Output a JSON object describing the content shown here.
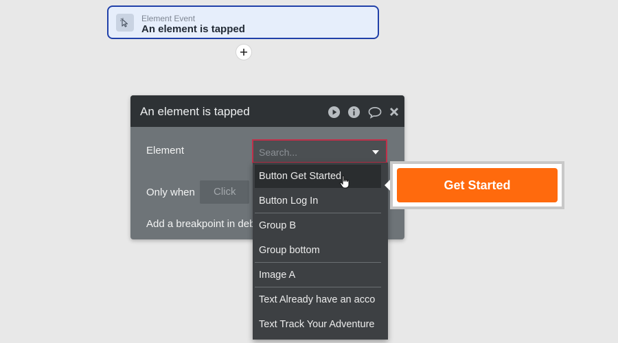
{
  "event": {
    "kind_label": "Element Event",
    "title": "An element is tapped",
    "icon": "cursor-click-icon",
    "add_icon": "plus-icon"
  },
  "panel": {
    "title": "An element is tapped",
    "header_icons": [
      "play-icon",
      "info-icon",
      "comment-icon",
      "close-icon"
    ],
    "element_label": "Element",
    "search_placeholder": "Search...",
    "only_when_label": "Only when",
    "only_when_value": "Click",
    "breakpoint_label": "Add a breakpoint in deb"
  },
  "dropdown": {
    "items": [
      {
        "label": "Button Get Started"
      },
      {
        "label": "Button Log In"
      },
      {
        "label": "Group B"
      },
      {
        "label": "Group bottom"
      },
      {
        "label": "Image A"
      },
      {
        "label": "Text Already have an acco"
      },
      {
        "label": "Text Track Your Adventure"
      }
    ],
    "highlighted_index": 0
  },
  "preview": {
    "button_label": "Get Started"
  },
  "colors": {
    "background": "#e8e8e8",
    "event_border": "#1f3fa8",
    "panel_header": "#2e3235",
    "panel_body": "#6e7478",
    "dropdown_bg": "#3d4043",
    "search_border": "#c0304a",
    "cta": "#ff6a0d"
  }
}
